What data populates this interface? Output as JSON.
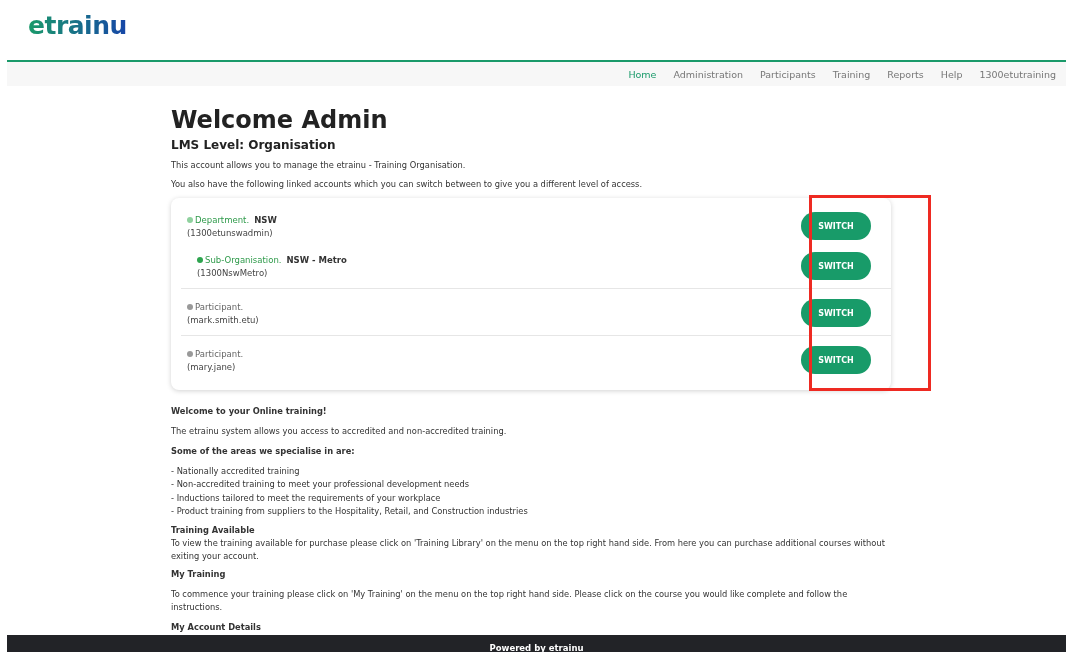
{
  "header": {
    "logo": "etrainu"
  },
  "nav": [
    {
      "label": "Home",
      "selected": true
    },
    {
      "label": "Administration",
      "selected": false
    },
    {
      "label": "Participants",
      "selected": false
    },
    {
      "label": "Training",
      "selected": false
    },
    {
      "label": "Reports",
      "selected": false
    },
    {
      "label": "Help",
      "selected": false
    },
    {
      "label": "1300etutraining",
      "selected": false
    }
  ],
  "title": "Welcome Admin",
  "subtitle": "LMS Level: Organisation",
  "intro": [
    "This account allows you to manage the etrainu - Training Organisation.",
    "You also have the following linked accounts which you can switch between to give you a different level of access."
  ],
  "accounts": [
    {
      "type": "Department.",
      "name": "NSW",
      "username": "(1300etunswadmin)",
      "color": "#8fd19e",
      "button": "SWITCH",
      "children": [
        {
          "type": "Sub-Organisation.",
          "name": "NSW - Metro",
          "username": "(1300NswMetro)",
          "color": "#2ea44f",
          "button": "SWITCH"
        }
      ]
    },
    {
      "type": "Participant.",
      "username": "(mark.smith.etu)",
      "color": "#999999",
      "button": "SWITCH"
    },
    {
      "type": "Participant.",
      "username": "(mary.jane)",
      "color": "#999999",
      "button": "SWITCH"
    }
  ],
  "switch_highlight": true,
  "sections": [
    {
      "kind": "heading",
      "text": "Welcome to your Online training!"
    },
    {
      "kind": "paragraph",
      "text": "The etrainu system allows you access to accredited and non-accredited training."
    },
    {
      "kind": "heading",
      "text": "Some of the areas we specialise in are:"
    },
    {
      "kind": "list",
      "items": [
        "- Nationally accredited training",
        "- Non-accredited training to meet your professional development needs",
        "- Inductions tailored to meet the requirements of your workplace",
        "- Product training from suppliers to the Hospitality, Retail, and Construction industries"
      ]
    },
    {
      "kind": "subheading",
      "text": "Training Available"
    },
    {
      "kind": "tightparagraph",
      "text": "To view the training available for purchase please click on 'Training Library' on the menu on the top right hand side. From here you can purchase additional courses without exiting your account."
    },
    {
      "kind": "heading",
      "text": "My Training"
    },
    {
      "kind": "paragraph",
      "text": "To commence your training please click on 'My Training' on the menu on the top right hand side. Please click on the course you would like complete and follow the instructions."
    },
    {
      "kind": "heading",
      "text": "My Account Details"
    }
  ],
  "footer": "Powered by etrainu"
}
